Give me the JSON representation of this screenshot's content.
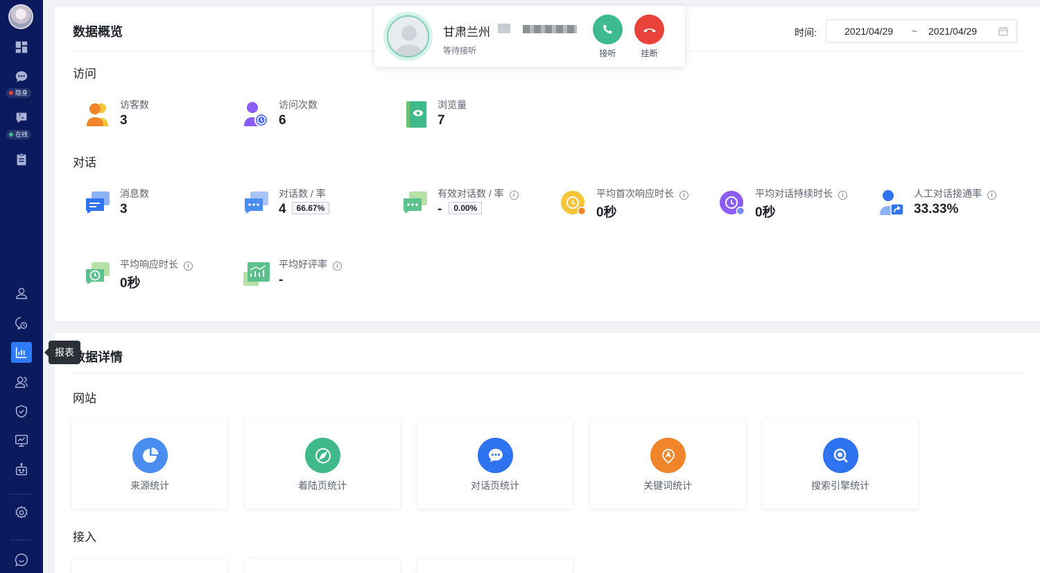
{
  "sidebar": {
    "status_hidden": "隐身",
    "status_online": "在线",
    "tooltip": "报表"
  },
  "overview": {
    "title": "数据概览",
    "time_label": "时间:",
    "date_start": "2021/04/29",
    "date_sep": "~",
    "date_end": "2021/04/29",
    "visit_section": "访问",
    "visits": [
      {
        "label": "访客数",
        "value": "3"
      },
      {
        "label": "访问次数",
        "value": "6"
      },
      {
        "label": "浏览量",
        "value": "7"
      }
    ],
    "chat_section": "对话",
    "chats": [
      {
        "label": "消息数",
        "value": "3"
      },
      {
        "label": "对话数 / 率",
        "value": "4",
        "rate": "66.67%"
      },
      {
        "label": "有效对话数 / 率",
        "value": "-",
        "rate": "0.00%"
      },
      {
        "label": "平均首次响应时长",
        "value": "0秒"
      },
      {
        "label": "平均对话持续时长",
        "value": "0秒"
      },
      {
        "label": "人工对话接通率",
        "value": "33.33%"
      },
      {
        "label": "平均响应时长",
        "value": "0秒"
      },
      {
        "label": "平均好评率",
        "value": "-"
      }
    ]
  },
  "details": {
    "title": "数据详情",
    "website_section": "网站",
    "tiles": [
      {
        "label": "来源统计",
        "color": "#4a8df0"
      },
      {
        "label": "着陆页统计",
        "color": "#3fb98a"
      },
      {
        "label": "对话页统计",
        "color": "#2f73f0"
      },
      {
        "label": "关键词统计",
        "color": "#f0852c"
      },
      {
        "label": "搜索引擎统计",
        "color": "#2f73f0"
      }
    ],
    "access_section": "接入"
  },
  "call": {
    "caller": "甘肃兰州",
    "status": "等待接听",
    "accept": "接听",
    "hangup": "挂断",
    "accept_color": "#3dba8f",
    "hangup_color": "#e8423a"
  }
}
